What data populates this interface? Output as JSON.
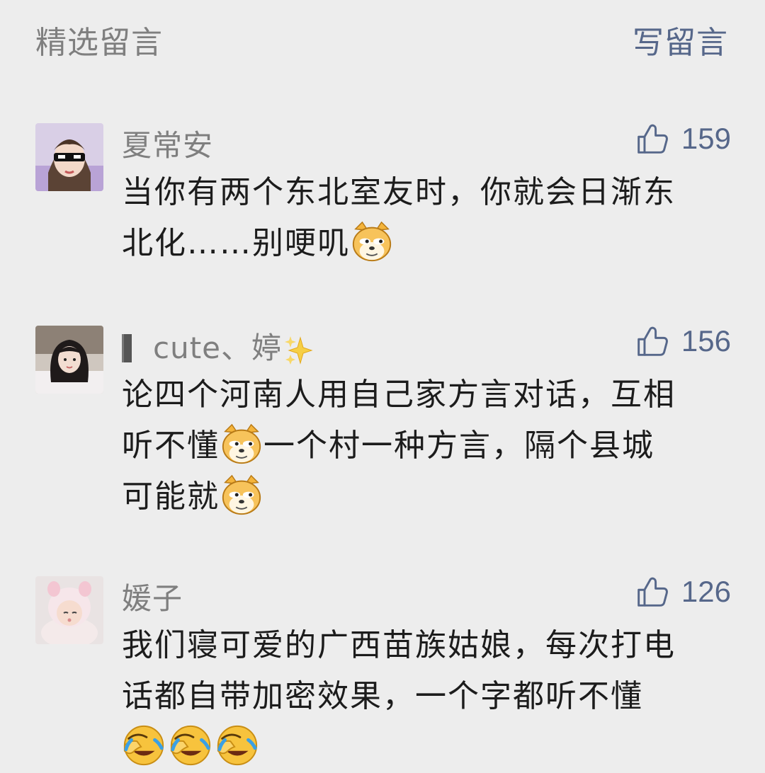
{
  "header": {
    "title": "精选留言",
    "write_label": "写留言"
  },
  "comments": [
    {
      "nickname": "夏常安",
      "likes": "159",
      "line1": "当你有两个东北室友时，你就会日渐东",
      "line2": "北化……别哽叽",
      "emoji": "doge-icon"
    },
    {
      "nickname_prefix": "▍",
      "nickname": "cute、婷",
      "nickname_suffix_icon": "sparkles-icon",
      "likes": "156",
      "line1": "论四个河南人用自己家方言对话，互相",
      "line2_a": "听不懂",
      "line2_b": "一个村一种方言，隔个县城",
      "line3": "可能就",
      "emoji": "doge-icon"
    },
    {
      "nickname": "媛子",
      "likes": "126",
      "line1": "我们寝可爱的广西苗族姑娘，每次打电",
      "line2": "话都自带加密效果，一个字都听不懂",
      "emoji": "facepalm-cry-icon",
      "emoji_count": 3
    }
  ]
}
